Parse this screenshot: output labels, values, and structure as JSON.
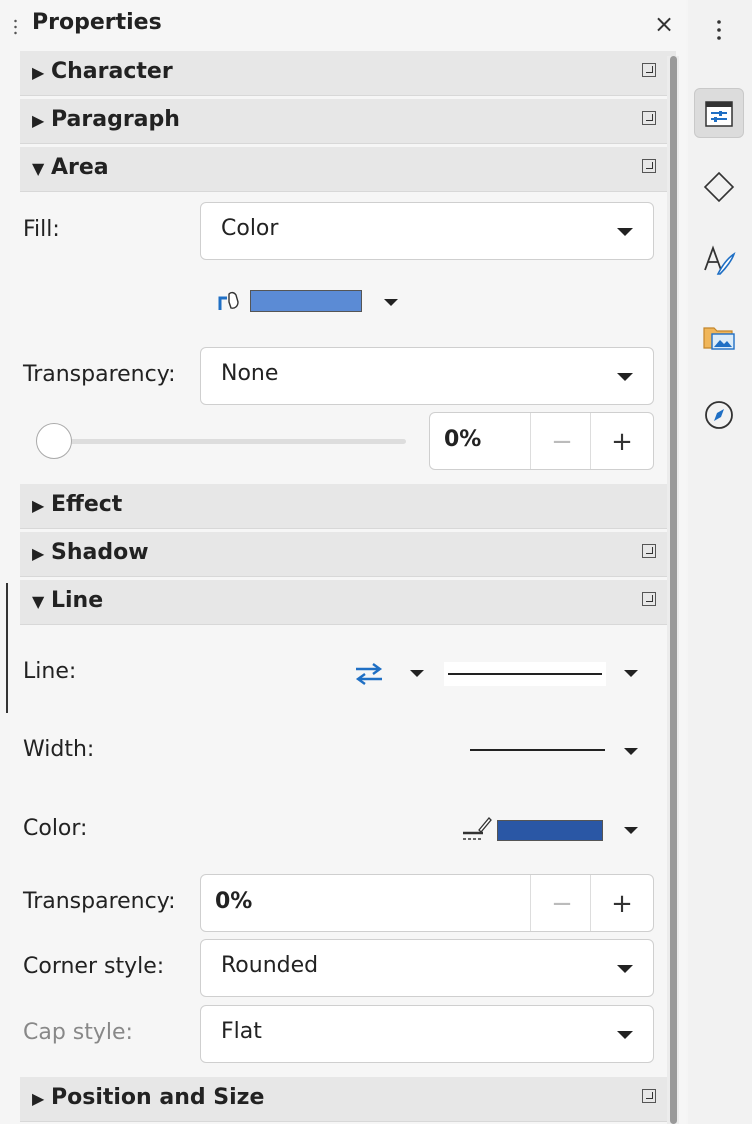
{
  "title": "Properties",
  "sections": {
    "character": "Character",
    "paragraph": "Paragraph",
    "area": "Area",
    "effect": "Effect",
    "shadow": "Shadow",
    "line": "Line",
    "position": "Position and Size"
  },
  "area": {
    "fill_label": "Fill:",
    "fill_value": "Color",
    "fill_color": "#5b8bd5",
    "transparency_label": "Transparency:",
    "transparency_value": "None",
    "slider_value": "0%",
    "slider_level": 0
  },
  "line": {
    "line_label": "Line:",
    "width_label": "Width:",
    "color_label": "Color:",
    "line_color": "#2a57a5",
    "transparency_label": "Transparency:",
    "transparency_value": "0%",
    "corner_label": "Corner style:",
    "corner_value": "Rounded",
    "cap_label": "Cap style:",
    "cap_value": "Flat"
  },
  "close_glyph": "×",
  "minus_glyph": "−",
  "plus_glyph": "+",
  "colors": {
    "accent": "#1f6fc4",
    "section_bg": "#e7e7e7"
  }
}
